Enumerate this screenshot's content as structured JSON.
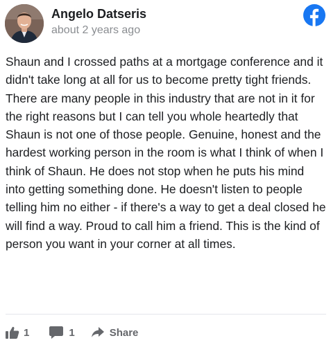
{
  "post": {
    "author_name": "Angelo Datseris",
    "timestamp": "about 2 years ago",
    "body": "Shaun and I crossed paths at a mortgage conference and it didn't take long at all for us to become pretty tight friends. There are many people in this industry that are not in it for the right reasons but I can tell you whole heartedly that Shaun is not one of those people. Genuine, honest and the hardest working person in the room is what I think of when I think of Shaun. He does not stop when he puts his mind into getting something done. He doesn't listen to people telling him no either - if there's a way to get a deal closed he will find a way. Proud to call him a friend. This is the kind of person you want in your corner at all times."
  },
  "actions": {
    "like_count": "1",
    "comment_count": "1",
    "share_label": "Share"
  },
  "icons": {
    "brand": "facebook-logo-icon",
    "like": "thumbs-up-icon",
    "comment": "comment-bubble-icon",
    "share": "share-arrow-icon"
  },
  "colors": {
    "brand_blue": "#1877f2",
    "muted_text": "#8a8d91",
    "action_text": "#65676b",
    "body_text": "#1c1e21"
  }
}
